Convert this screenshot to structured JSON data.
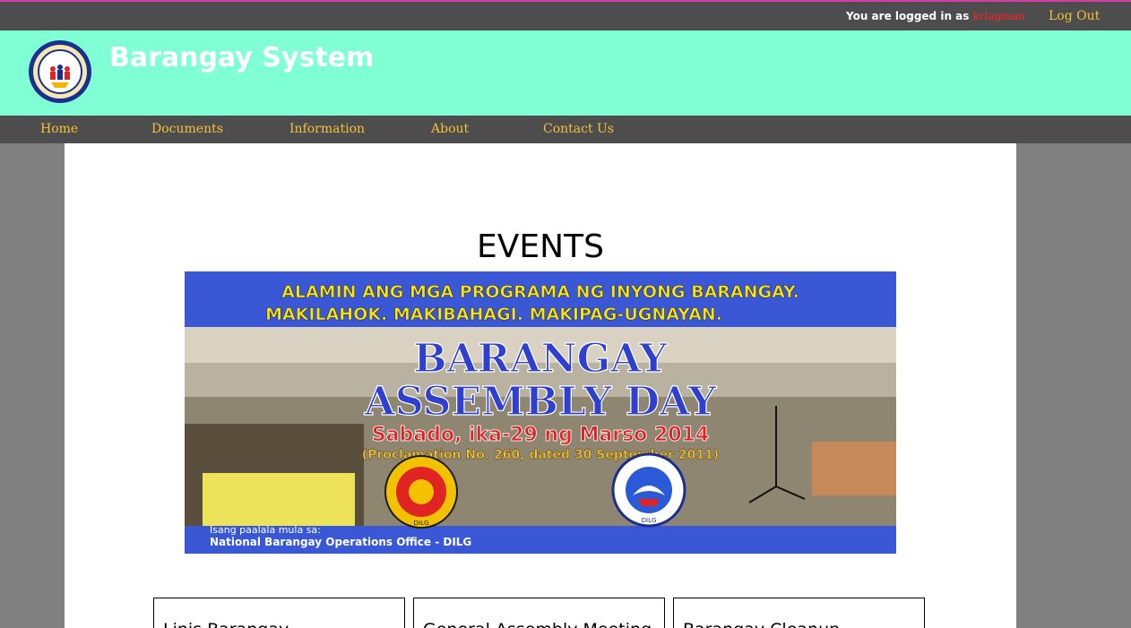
{
  "topbar": {
    "logged_in_prefix": "You are logged in as",
    "username": "krlagman",
    "logout_label": "Log Out"
  },
  "header": {
    "site_title": "Barangay System"
  },
  "nav": {
    "items": [
      {
        "label": "Home"
      },
      {
        "label": "Documents"
      },
      {
        "label": "Information"
      },
      {
        "label": "About"
      },
      {
        "label": "Contact Us"
      }
    ]
  },
  "main": {
    "events_heading": "EVENTS",
    "banner": {
      "line1": "ALAMIN ANG MGA PROGRAMA NG INYONG BARANGAY.",
      "line2": "MAKILAHOK. MAKIBAHAGI. MAKIPAG-UGNAYAN.",
      "title1": "BARANGAY",
      "title2": "ASSEMBLY DAY",
      "date": "Sabado, ika-29 ng Marso 2014",
      "proclamation": "(Proclamation No. 260, dated 30 September 2011)",
      "reminder_prefix": "Isang paalala mula sa:",
      "office": "National Barangay Operations Office  - DILG",
      "seal_left_text": "DILG",
      "seal_right_text": "DILG"
    },
    "cards": [
      {
        "title": "Linis Barangay"
      },
      {
        "title": "General Assembly Meeting"
      },
      {
        "title": "Barangay Cleanup"
      }
    ]
  },
  "colors": {
    "topbar_bg": "#4d4d4d",
    "header_bg": "#80ffd4",
    "nav_text": "#f2c23a",
    "username": "#ff2020",
    "page_bg": "#808080",
    "banner_blue": "#3a58d6",
    "banner_yellow": "#ffe600"
  }
}
